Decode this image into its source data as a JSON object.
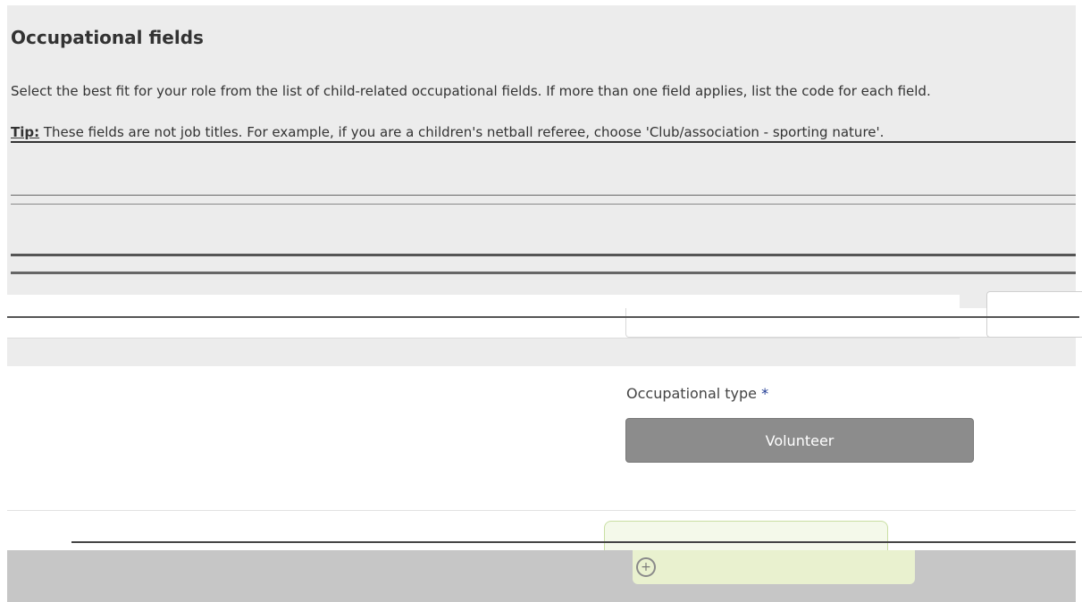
{
  "section": {
    "title": "Occupational fields",
    "intro": "Select the best fit for your role from the list of child-related occupational fields. If more than one field applies, list the code for each field.",
    "tip_label": "Tip:",
    "tip_text": " These fields are not job titles. For example, if you are a children's netball referee, choose 'Club/association - sporting nature'."
  },
  "occupational_type": {
    "label": "Occupational type",
    "required_marker": "*",
    "selected_value": "Volunteer"
  },
  "colors": {
    "panel_bg": "#ececec",
    "button_bg": "#8c8c8c",
    "required": "#1f3a93",
    "add_button_bg": "#e9f1cf"
  },
  "icons": {
    "add": "plus-circle-icon"
  }
}
